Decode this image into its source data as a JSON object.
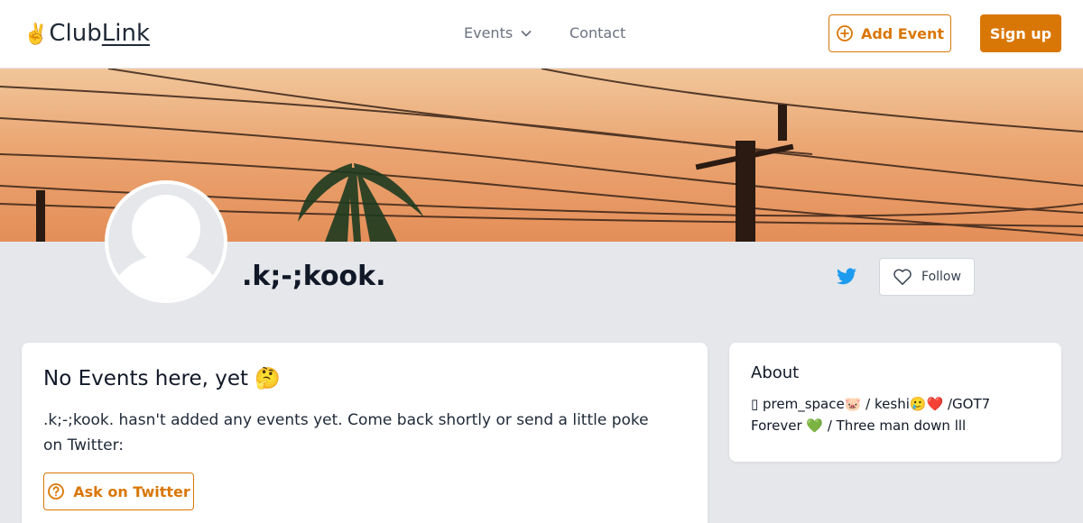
{
  "header": {
    "logo_hand": "✌️",
    "logo_club": "Club",
    "logo_link": "Link",
    "nav_events": "Events",
    "nav_contact": "Contact",
    "add_event_label": "Add Event",
    "signup_label": "Sign up"
  },
  "profile": {
    "name": ".k;-;kook.",
    "follow_label": "Follow"
  },
  "events_card": {
    "title": "No Events here, yet 🤔",
    "message": ".k;-;kook. hasn't added any events yet. Come back shortly or send a little poke on Twitter:",
    "ask_button_label": "Ask on Twitter"
  },
  "about_card": {
    "title": "About",
    "text": "▯ prem_space🐷 / keshi🥲❤️ /GOT7 Forever 💚 / Three man down lll"
  },
  "colors": {
    "accent": "#d97706",
    "twitter": "#1d9bf0",
    "page_bg": "#e5e7eb"
  },
  "icons": {
    "events_dropdown": "chevron-down-icon",
    "add_event": "plus-circle-icon",
    "twitter": "twitter-icon",
    "follow": "heart-icon",
    "ask": "question-circle-icon"
  }
}
